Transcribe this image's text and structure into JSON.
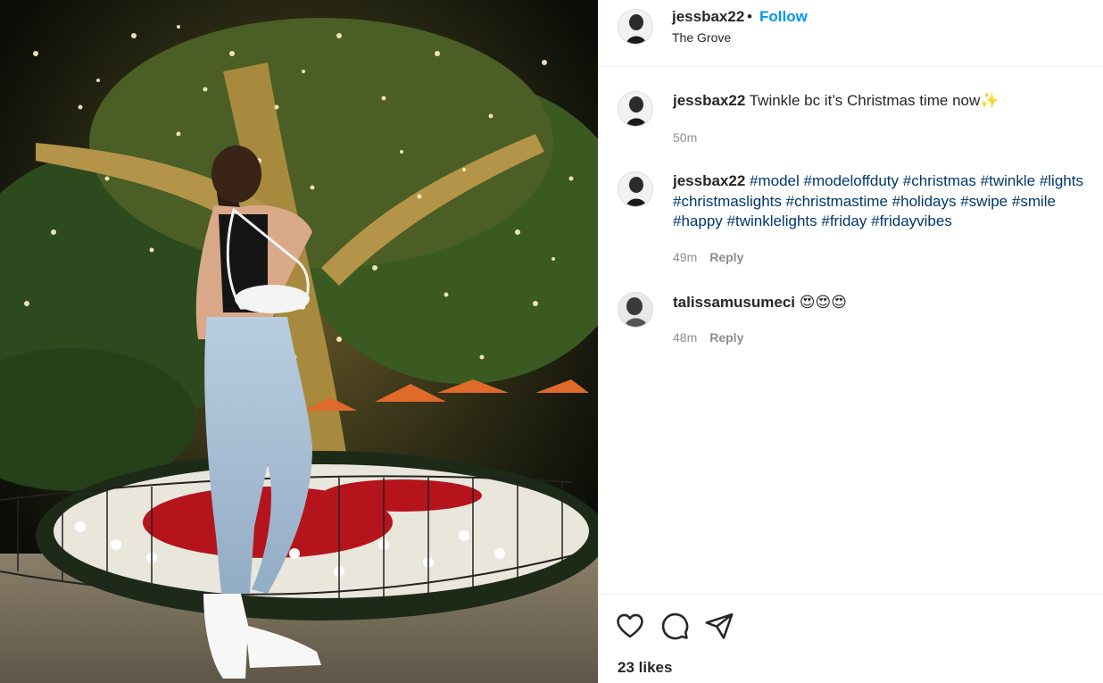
{
  "post": {
    "author": "jessbax22",
    "follow_label": "Follow",
    "separator": "•",
    "location": "The Grove"
  },
  "comments": [
    {
      "user": "jessbax22",
      "text": "Twinkle bc it’s Christmas time now",
      "emoji": "✨",
      "time": "50m"
    },
    {
      "user": "jessbax22",
      "hashtags": [
        "#model",
        "#modeloffduty",
        "#christmas",
        "#twinkle",
        "#lights",
        "#christmaslights",
        "#christmastime",
        "#holidays",
        "#swipe",
        "#smile",
        "#happy",
        "#twinklelights",
        "#friday",
        "#fridayvibes"
      ],
      "time": "49m",
      "reply_label": "Reply"
    },
    {
      "user": "talissamusumeci",
      "emoji": "😍😍😍",
      "time": "48m",
      "reply_label": "Reply"
    }
  ],
  "actions": {
    "like_icon": "heart-icon",
    "comment_icon": "comment-bubble-icon",
    "share_icon": "paper-plane-icon",
    "likes_text": "23 likes"
  },
  "colors": {
    "follow_blue": "#0095f6",
    "hashtag_blue": "#00376b",
    "meta_gray": "#8e8e8e"
  }
}
